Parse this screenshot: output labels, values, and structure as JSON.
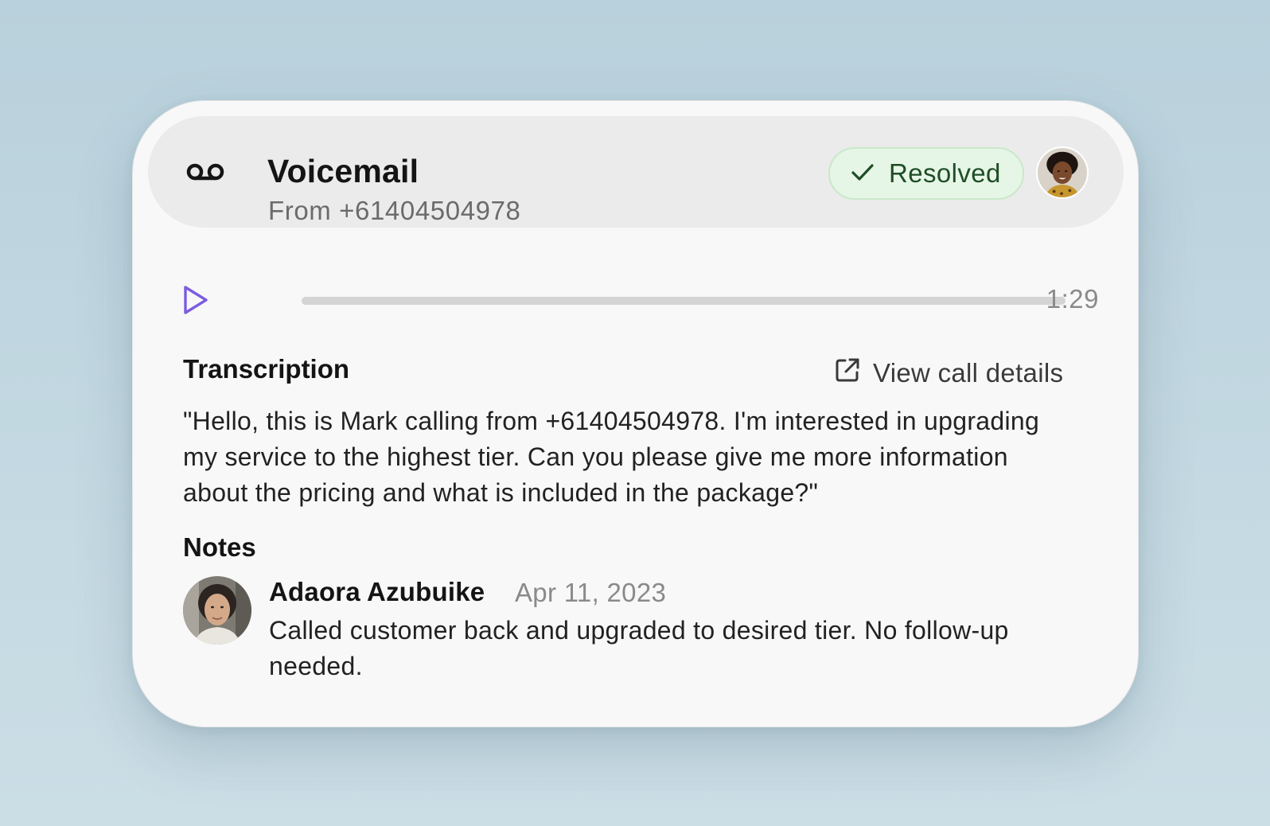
{
  "voicemail": {
    "title": "Voicemail",
    "from": "From +61404504978",
    "status": "Resolved",
    "icon": "voicemail-icon",
    "status_color": "#1f4d26",
    "status_bg": "#e6f6e6"
  },
  "player": {
    "duration": "1:29",
    "progress": 0,
    "accent_color": "#7c5ce0"
  },
  "transcription": {
    "heading": "Transcription",
    "view_details_label": "View call details",
    "text": "\"Hello, this is Mark calling from +61404504978. I'm interested in upgrading my service to the highest tier. Can you please give me more information about the pricing and what is included in the package?\""
  },
  "notes": {
    "heading": "Notes",
    "items": [
      {
        "author": "Adaora Azubuike",
        "date": "Apr 11, 2023",
        "text": "Called customer back and upgraded to desired tier. No follow-up needed."
      }
    ]
  }
}
